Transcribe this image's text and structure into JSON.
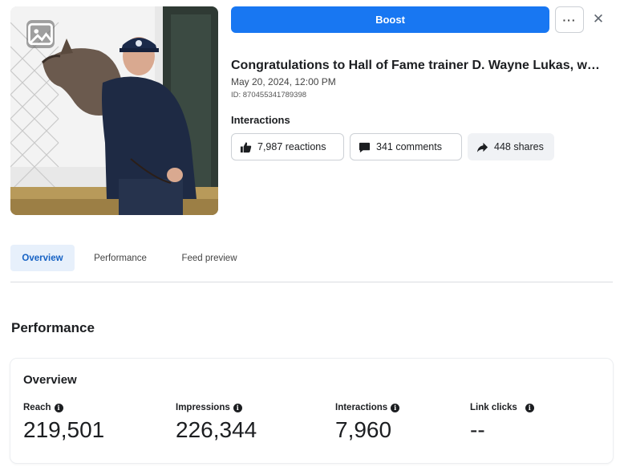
{
  "post": {
    "title": "Congratulations to Hall of Fame trainer D. Wayne Lukas, w…",
    "date": "May 20, 2024, 12:00 PM",
    "id": "ID: 870455341789398"
  },
  "actions": {
    "boost_label": "Boost",
    "more_label": "···",
    "close_label": "✕"
  },
  "interactions": {
    "label": "Interactions",
    "reactions": "7,987 reactions",
    "comments": "341 comments",
    "shares": "448 shares"
  },
  "tabs": [
    {
      "label": "Overview"
    },
    {
      "label": "Performance"
    },
    {
      "label": "Feed preview"
    }
  ],
  "performance": {
    "section_title": "Performance",
    "card_title": "Overview",
    "metrics": [
      {
        "label": "Reach",
        "value": "219,501"
      },
      {
        "label": "Impressions",
        "value": "226,344"
      },
      {
        "label": "Interactions",
        "value": "7,960"
      },
      {
        "label": "Link clicks",
        "value": "--"
      }
    ]
  },
  "colors": {
    "accent": "#1877f2",
    "active_tab_bg": "#e7f0fb",
    "active_tab_text": "#1662c4"
  }
}
